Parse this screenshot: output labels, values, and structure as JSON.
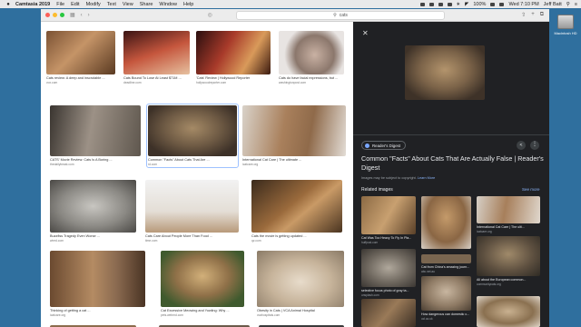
{
  "menubar": {
    "app_name": "Camtasia 2019",
    "menus": [
      "File",
      "Edit",
      "Modify",
      "Text",
      "View",
      "Share",
      "Window",
      "Help"
    ],
    "battery": "100%",
    "clock": "Wed 7:10 PM",
    "user": "Jeff Batt"
  },
  "desktop": {
    "drive_label": "Macintosh HD"
  },
  "browser": {
    "address": "cats"
  },
  "grid": {
    "tiles": [
      {
        "caption": "Cats review: A deep and inscrutable ...",
        "source": "vox.com"
      },
      {
        "caption": "Cats Bound To Lose At Least $71M ...",
        "source": "deadline.com"
      },
      {
        "caption": "'Cats' Review | Hollywood Reporter",
        "source": "hollywoodreporter.com"
      },
      {
        "caption": "Cats do have facial expressions, but ...",
        "source": "washingtonpost.com"
      },
      {
        "caption": "CATS' Movie Review: Cats Is A Boring ...",
        "source": "thedailybeast.com"
      },
      {
        "caption": "Common \"Facts\" About Cats That Are ...",
        "source": "rd.com"
      },
      {
        "caption": "International Cat Care | The ultimate ...",
        "source": "icatcare.org"
      },
      {
        "caption": "Buzzfiss Tragedy Even Worse ...",
        "source": "wired.com"
      },
      {
        "caption": "Cats Care About People More Than Food ...",
        "source": "time.com"
      },
      {
        "caption": "Cats the movie is getting updated ...",
        "source": "qz.com"
      },
      {
        "caption": "Thinking of getting a cat ...",
        "source": "icatcare.org"
      },
      {
        "caption": "Cat Excessive Meowing and Yowling: Why ...",
        "source": "pets.webmd.com"
      },
      {
        "caption": "Obesity in Cats | VCA Animal Hospital",
        "source": "vcahospitals.com"
      }
    ]
  },
  "panel": {
    "publisher": "Reader's Digest",
    "title": "Common \"Facts\" About Cats That Are Actually False | Reader's Digest",
    "copyright": "Images may be subject to copyright.",
    "learn_more": "Learn More",
    "related_label": "Related images",
    "see_more": "See more",
    "related": [
      {
        "caption": "Cat Was Too Heavy To Fly In Pla...",
        "source": "huffpost.com"
      },
      {
        "caption": "International Cat Care | The ulti...",
        "source": "icatcare.org"
      },
      {
        "caption": "Cat from China's amazing journ...",
        "source": "abc.net.au"
      },
      {
        "caption": "selective focus photo of gray ta...",
        "source": "unsplash.com"
      },
      {
        "caption": "All about the European common...",
        "source": "communitycats.org"
      },
      {
        "caption": "How dangerous can domestic c...",
        "source": "ucl.ac.uk"
      }
    ]
  }
}
